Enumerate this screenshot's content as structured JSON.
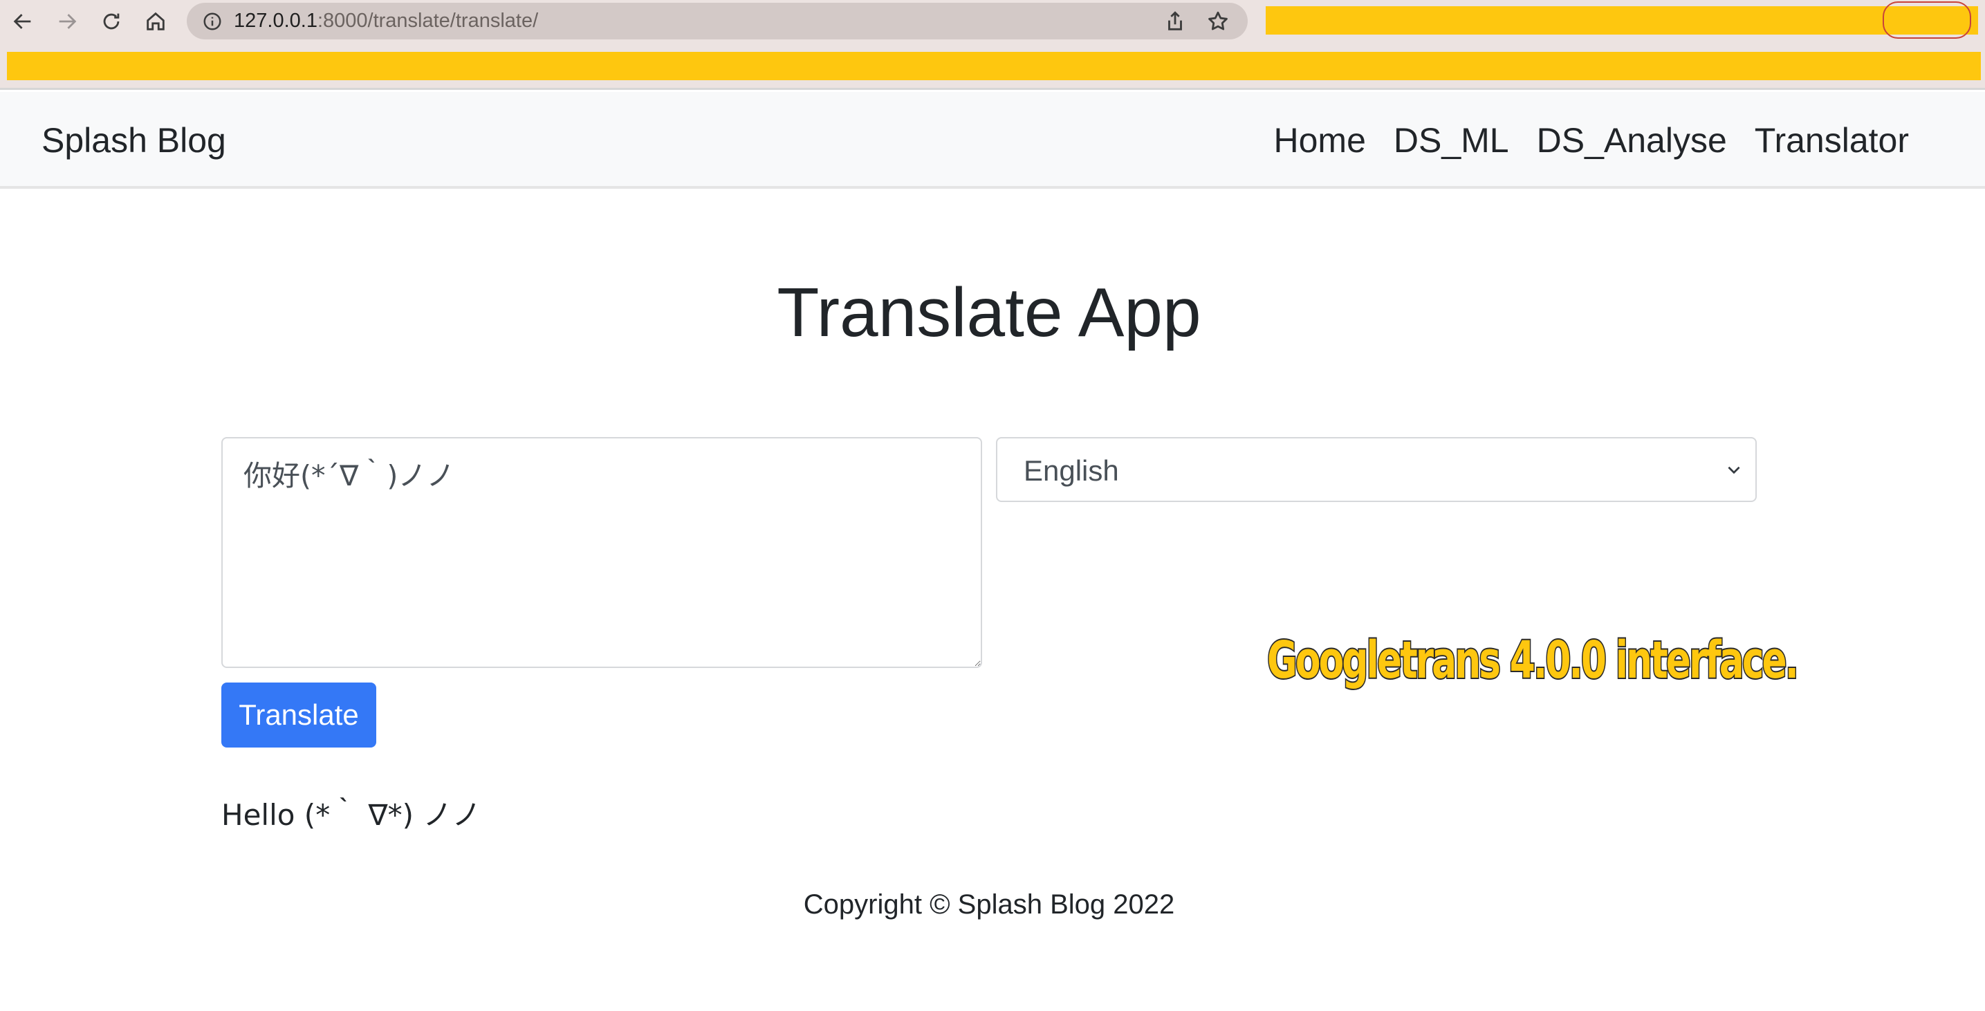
{
  "browser": {
    "url_host": "127.0.0.1",
    "url_path": ":8000/translate/translate/",
    "icons": [
      "back-arrow-icon",
      "forward-arrow-icon",
      "reload-icon",
      "home-icon",
      "info-icon",
      "share-icon",
      "star-icon"
    ]
  },
  "navbar": {
    "brand": "Splash Blog",
    "links": [
      "Home",
      "DS_ML",
      "DS_Analyse",
      "Translator"
    ]
  },
  "main": {
    "title": "Translate App",
    "source_text": "你好(*´∇｀)ノノ",
    "language_select": {
      "selected": "English"
    },
    "translate_button": "Translate",
    "result": "Hello (*｀ ∇*) ノノ",
    "caption": "Googletrans 4.0.0 interface."
  },
  "footer": {
    "copyright": "Copyright © Splash Blog 2022"
  },
  "colors": {
    "highlight": "#fec70f",
    "primary": "#3478f6",
    "navbar_bg": "#f8f9fa"
  }
}
